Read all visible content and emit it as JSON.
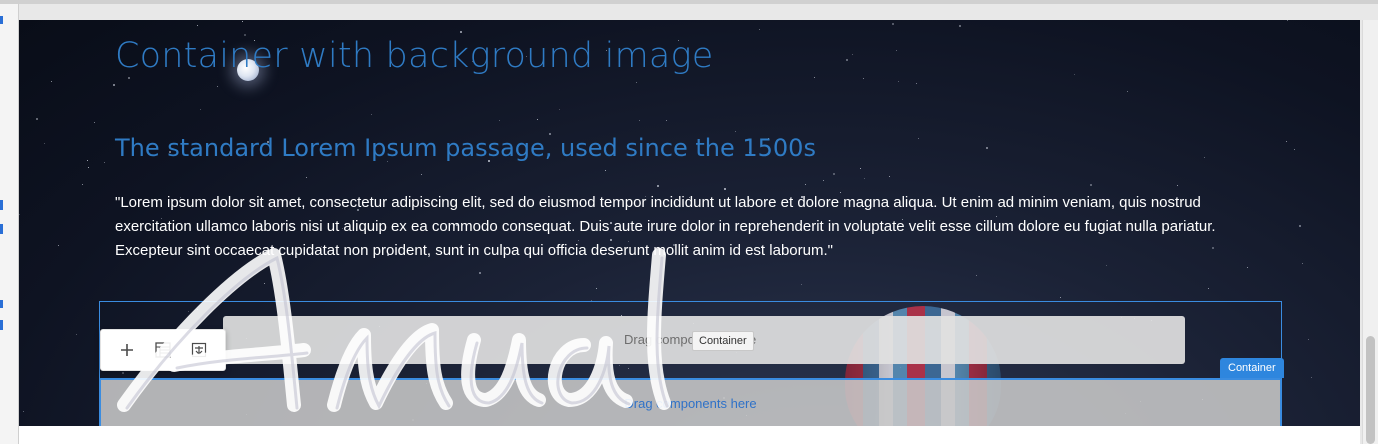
{
  "hero": {
    "title": "Container with background image",
    "subtitle": "The standard Lorem Ipsum passage, used since the 1500s",
    "paragraph": "\"Lorem ipsum dolor sit amet, consectetur adipiscing elit, sed do eiusmod tempor incididunt ut labore et dolore magna aliqua. Ut enim ad minim veniam, quis nostrud exercitation ullamco laboris nisi ut aliquip ex ea commodo consequat. Duis aute irure dolor in reprehenderit in voluptate velit esse cillum dolore eu fugiat nulla pariatur. Excepteur sint occaecat cupidatat non proident, sunt in culpa qui officia deserunt mollit anim id est laborum.\""
  },
  "editor": {
    "drop_zone_text": "Drag components here",
    "tooltip": "Container",
    "container_badge": "Container",
    "toolbar": [
      {
        "icon": "plus-icon",
        "label": "Insert component"
      },
      {
        "icon": "layout-icon",
        "label": "Layout"
      },
      {
        "icon": "container-icon",
        "label": "Parent"
      }
    ]
  },
  "watermark": "Annual",
  "colors": {
    "heading": "#2f7bc4",
    "accent": "#2e86de",
    "sky": "#0e1322"
  }
}
